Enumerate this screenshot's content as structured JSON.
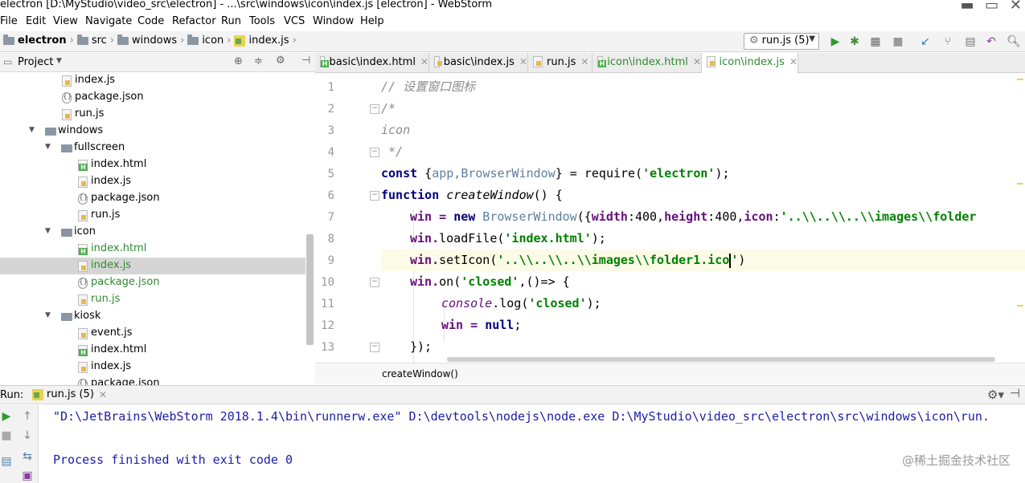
{
  "window": {
    "title": "electron [D:\\MyStudio\\video_src\\electron] - ...\\src\\windows\\icon\\index.js [electron] - WebStorm"
  },
  "menu": [
    "File",
    "Edit",
    "View",
    "Navigate",
    "Code",
    "Refactor",
    "Run",
    "Tools",
    "VCS",
    "Window",
    "Help"
  ],
  "navbar": {
    "crumbs": [
      "electron",
      "src",
      "windows",
      "icon",
      "index.js"
    ],
    "run_config": "run.js (5)"
  },
  "project": {
    "header": "Project",
    "tree": [
      {
        "label": "index.js",
        "type": "js",
        "green": false
      },
      {
        "label": "package.json",
        "type": "json",
        "green": false
      },
      {
        "label": "run.js",
        "type": "js",
        "green": false
      },
      {
        "label": "windows",
        "type": "folder",
        "green": false
      },
      {
        "label": "fullscreen",
        "type": "folder",
        "green": false
      },
      {
        "label": "index.html",
        "type": "html",
        "green": false
      },
      {
        "label": "index.js",
        "type": "js",
        "green": false
      },
      {
        "label": "package.json",
        "type": "json",
        "green": false
      },
      {
        "label": "run.js",
        "type": "js",
        "green": false
      },
      {
        "label": "icon",
        "type": "folder",
        "green": false
      },
      {
        "label": "index.html",
        "type": "html",
        "green": true
      },
      {
        "label": "index.js",
        "type": "js",
        "green": true
      },
      {
        "label": "package.json",
        "type": "json",
        "green": true
      },
      {
        "label": "run.js",
        "type": "js",
        "green": true
      },
      {
        "label": "kiosk",
        "type": "folder",
        "green": false
      },
      {
        "label": "event.js",
        "type": "js",
        "green": false
      },
      {
        "label": "index.html",
        "type": "html",
        "green": false
      },
      {
        "label": "index.js",
        "type": "js",
        "green": false
      },
      {
        "label": "package.json",
        "type": "json",
        "green": false
      }
    ]
  },
  "tabs": [
    {
      "label": "basic\\index.html",
      "type": "html"
    },
    {
      "label": "basic\\index.js",
      "type": "js"
    },
    {
      "label": "run.js",
      "type": "js"
    },
    {
      "label": "icon\\index.html",
      "type": "html"
    },
    {
      "label": "icon\\index.js",
      "type": "js"
    }
  ],
  "editor": {
    "line_numbers": [
      "1",
      "2",
      "3",
      "4",
      "5",
      "6",
      "7",
      "8",
      "9",
      "10",
      "11",
      "12",
      "13"
    ],
    "code": {
      "l1": "// 设置窗口图标",
      "l2": "/*",
      "l3": "icon",
      "l4": " */",
      "l5_kw": "const",
      "l5_a": " {",
      "l5_b": "app,BrowserWindow",
      "l5_c": "} = require(",
      "l5_str": "'electron'",
      "l5_d": ");",
      "l6_kw": "function",
      "l6_fn": " createWindow",
      "l6_rest": "() {",
      "l7_a": "win = ",
      "l7_kw": "new",
      "l7_cls": " BrowserWindow",
      "l7_b": "({",
      "l7_p1": "width",
      "l7_v1": ":400,",
      "l7_p2": "height",
      "l7_v2": ":400,",
      "l7_p3": "icon",
      "l7_v3": ":",
      "l7_str": "'..\\\\..\\\\..\\\\images\\\\folder",
      "l8_a": "win.",
      "l8_m": "loadFile",
      "l8_b": "(",
      "l8_str": "'index.html'",
      "l8_c": ");",
      "l9_a": "win.",
      "l9_m": "setIcon",
      "l9_b": "(",
      "l9_str": "'..\\\\..\\\\..\\\\images\\\\folder1.ico",
      "l9_str2": "'",
      "l9_c": ")",
      "l10_a": "win.",
      "l10_m": "on",
      "l10_b": "(",
      "l10_str": "'closed'",
      "l10_c": ",()=> {",
      "l11_a": "console",
      "l11_b": ".",
      "l11_m": "log",
      "l11_c": "(",
      "l11_str": "'closed'",
      "l11_d": ");",
      "l12_a": "win = ",
      "l12_kw": "null",
      "l12_b": ";",
      "l13": "});"
    },
    "breadcrumb": "createWindow()"
  },
  "run": {
    "label": "Run:",
    "tab": "run.js (5)",
    "console": [
      "\"D:\\JetBrains\\WebStorm 2018.1.4\\bin\\runnerw.exe\" D:\\devtools\\nodejs\\node.exe D:\\MyStudio\\video_src\\electron\\src\\windows\\icon\\run.",
      "Process finished with exit code 0"
    ]
  },
  "watermark": "@稀土掘金技术社区",
  "colors": {
    "keyword": "#000080",
    "string": "#008000",
    "comment": "#8c8c8c",
    "property": "#660e7a",
    "console_text": "#1c1ca8",
    "vcs_green": "#2f8a2f"
  }
}
